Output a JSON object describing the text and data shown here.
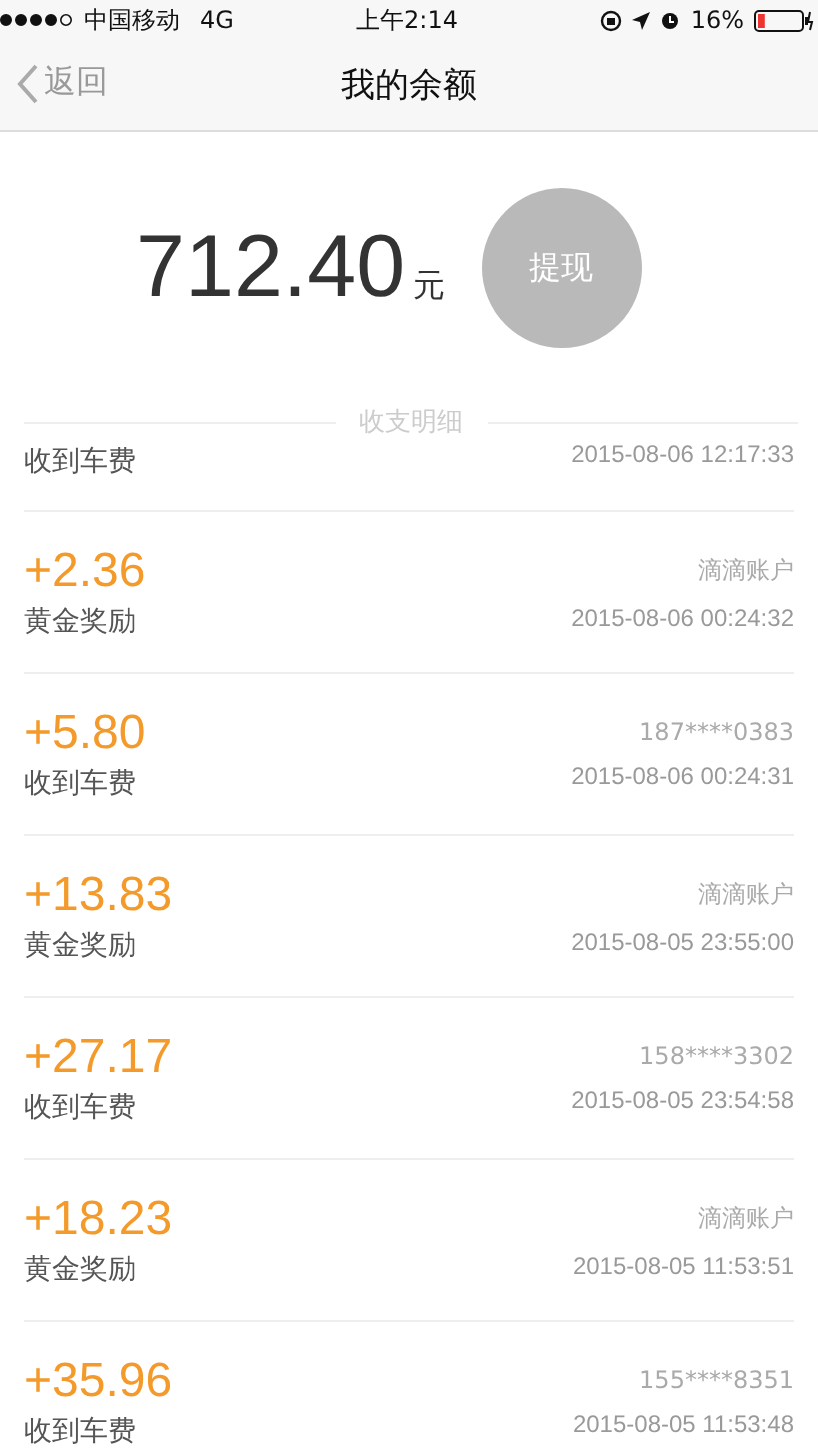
{
  "status_bar": {
    "carrier": "中国移动",
    "network": "4G",
    "time": "上午2:14",
    "battery_text": "16%"
  },
  "nav": {
    "back": "返回",
    "title": "我的余额"
  },
  "balance": {
    "amount": "712.40",
    "unit": "元",
    "withdraw": "提现"
  },
  "section_title": "收支明细",
  "partial_row": {
    "label": "收到车费",
    "time": "2015-08-06 12:17:33"
  },
  "rows": [
    {
      "amount": "+2.36",
      "label": "黄金奖励",
      "source": "滴滴账户",
      "time": "2015-08-06 00:24:32"
    },
    {
      "amount": "+5.80",
      "label": "收到车费",
      "source": "187****0383",
      "time": "2015-08-06 00:24:31"
    },
    {
      "amount": "+13.83",
      "label": "黄金奖励",
      "source": "滴滴账户",
      "time": "2015-08-05 23:55:00"
    },
    {
      "amount": "+27.17",
      "label": "收到车费",
      "source": "158****3302",
      "time": "2015-08-05 23:54:58"
    },
    {
      "amount": "+18.23",
      "label": "黄金奖励",
      "source": "滴滴账户",
      "time": "2015-08-05 11:53:51"
    },
    {
      "amount": "+35.96",
      "label": "收到车费",
      "source": "155****8351",
      "time": "2015-08-05 11:53:48"
    }
  ]
}
